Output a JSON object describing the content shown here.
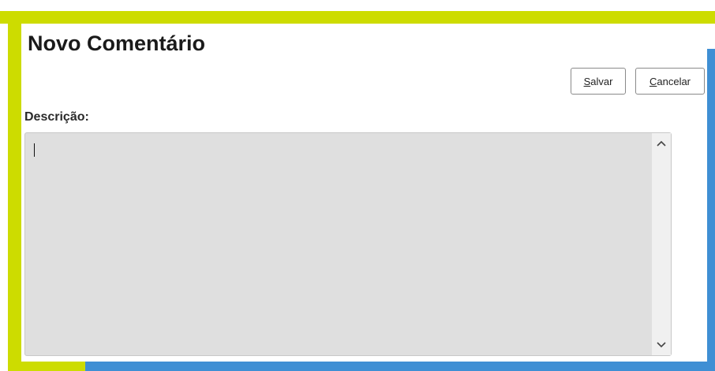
{
  "dialog": {
    "title": "Novo Comentário",
    "buttons": {
      "save": {
        "underlined": "S",
        "rest": "alvar"
      },
      "cancel": {
        "underlined": "C",
        "rest": "ancelar"
      }
    },
    "description": {
      "label": "Descrição:",
      "value": ""
    }
  },
  "icons": {
    "scroll_up": "chevron-up-icon",
    "scroll_down": "chevron-down-icon"
  },
  "colors": {
    "frame_green": "#cddc00",
    "frame_blue": "#3f8fd4",
    "field_background": "#dfdfdf"
  }
}
